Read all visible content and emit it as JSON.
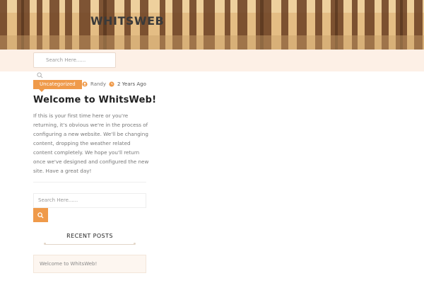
{
  "header": {
    "site_title": "WHITSWEB",
    "search_placeholder": "Search Here......"
  },
  "post": {
    "category": "Uncategorized",
    "author": "Randy",
    "date": "2 Years Ago",
    "title": "Welcome to WhitsWeb!",
    "body": "If this is your first time here or you're returning, it's obvious we're in the process of configuring a new website. We'll be changing content, dropping the weather related content completely. We hope you'll return once we've designed and configured the new site. Have a great day!"
  },
  "sidebar": {
    "search_placeholder": "Search Here......",
    "recent_posts_title": "RECENT POSTS",
    "recent_posts": [
      "Welcome to WhitsWeb!"
    ]
  },
  "colors": {
    "accent": "#ef9a4a",
    "nav_background": "#fdf0e6"
  },
  "icons": {
    "header_search": "search-icon",
    "author": "user-icon",
    "date": "clock-icon",
    "sidebar_search": "search-icon"
  }
}
